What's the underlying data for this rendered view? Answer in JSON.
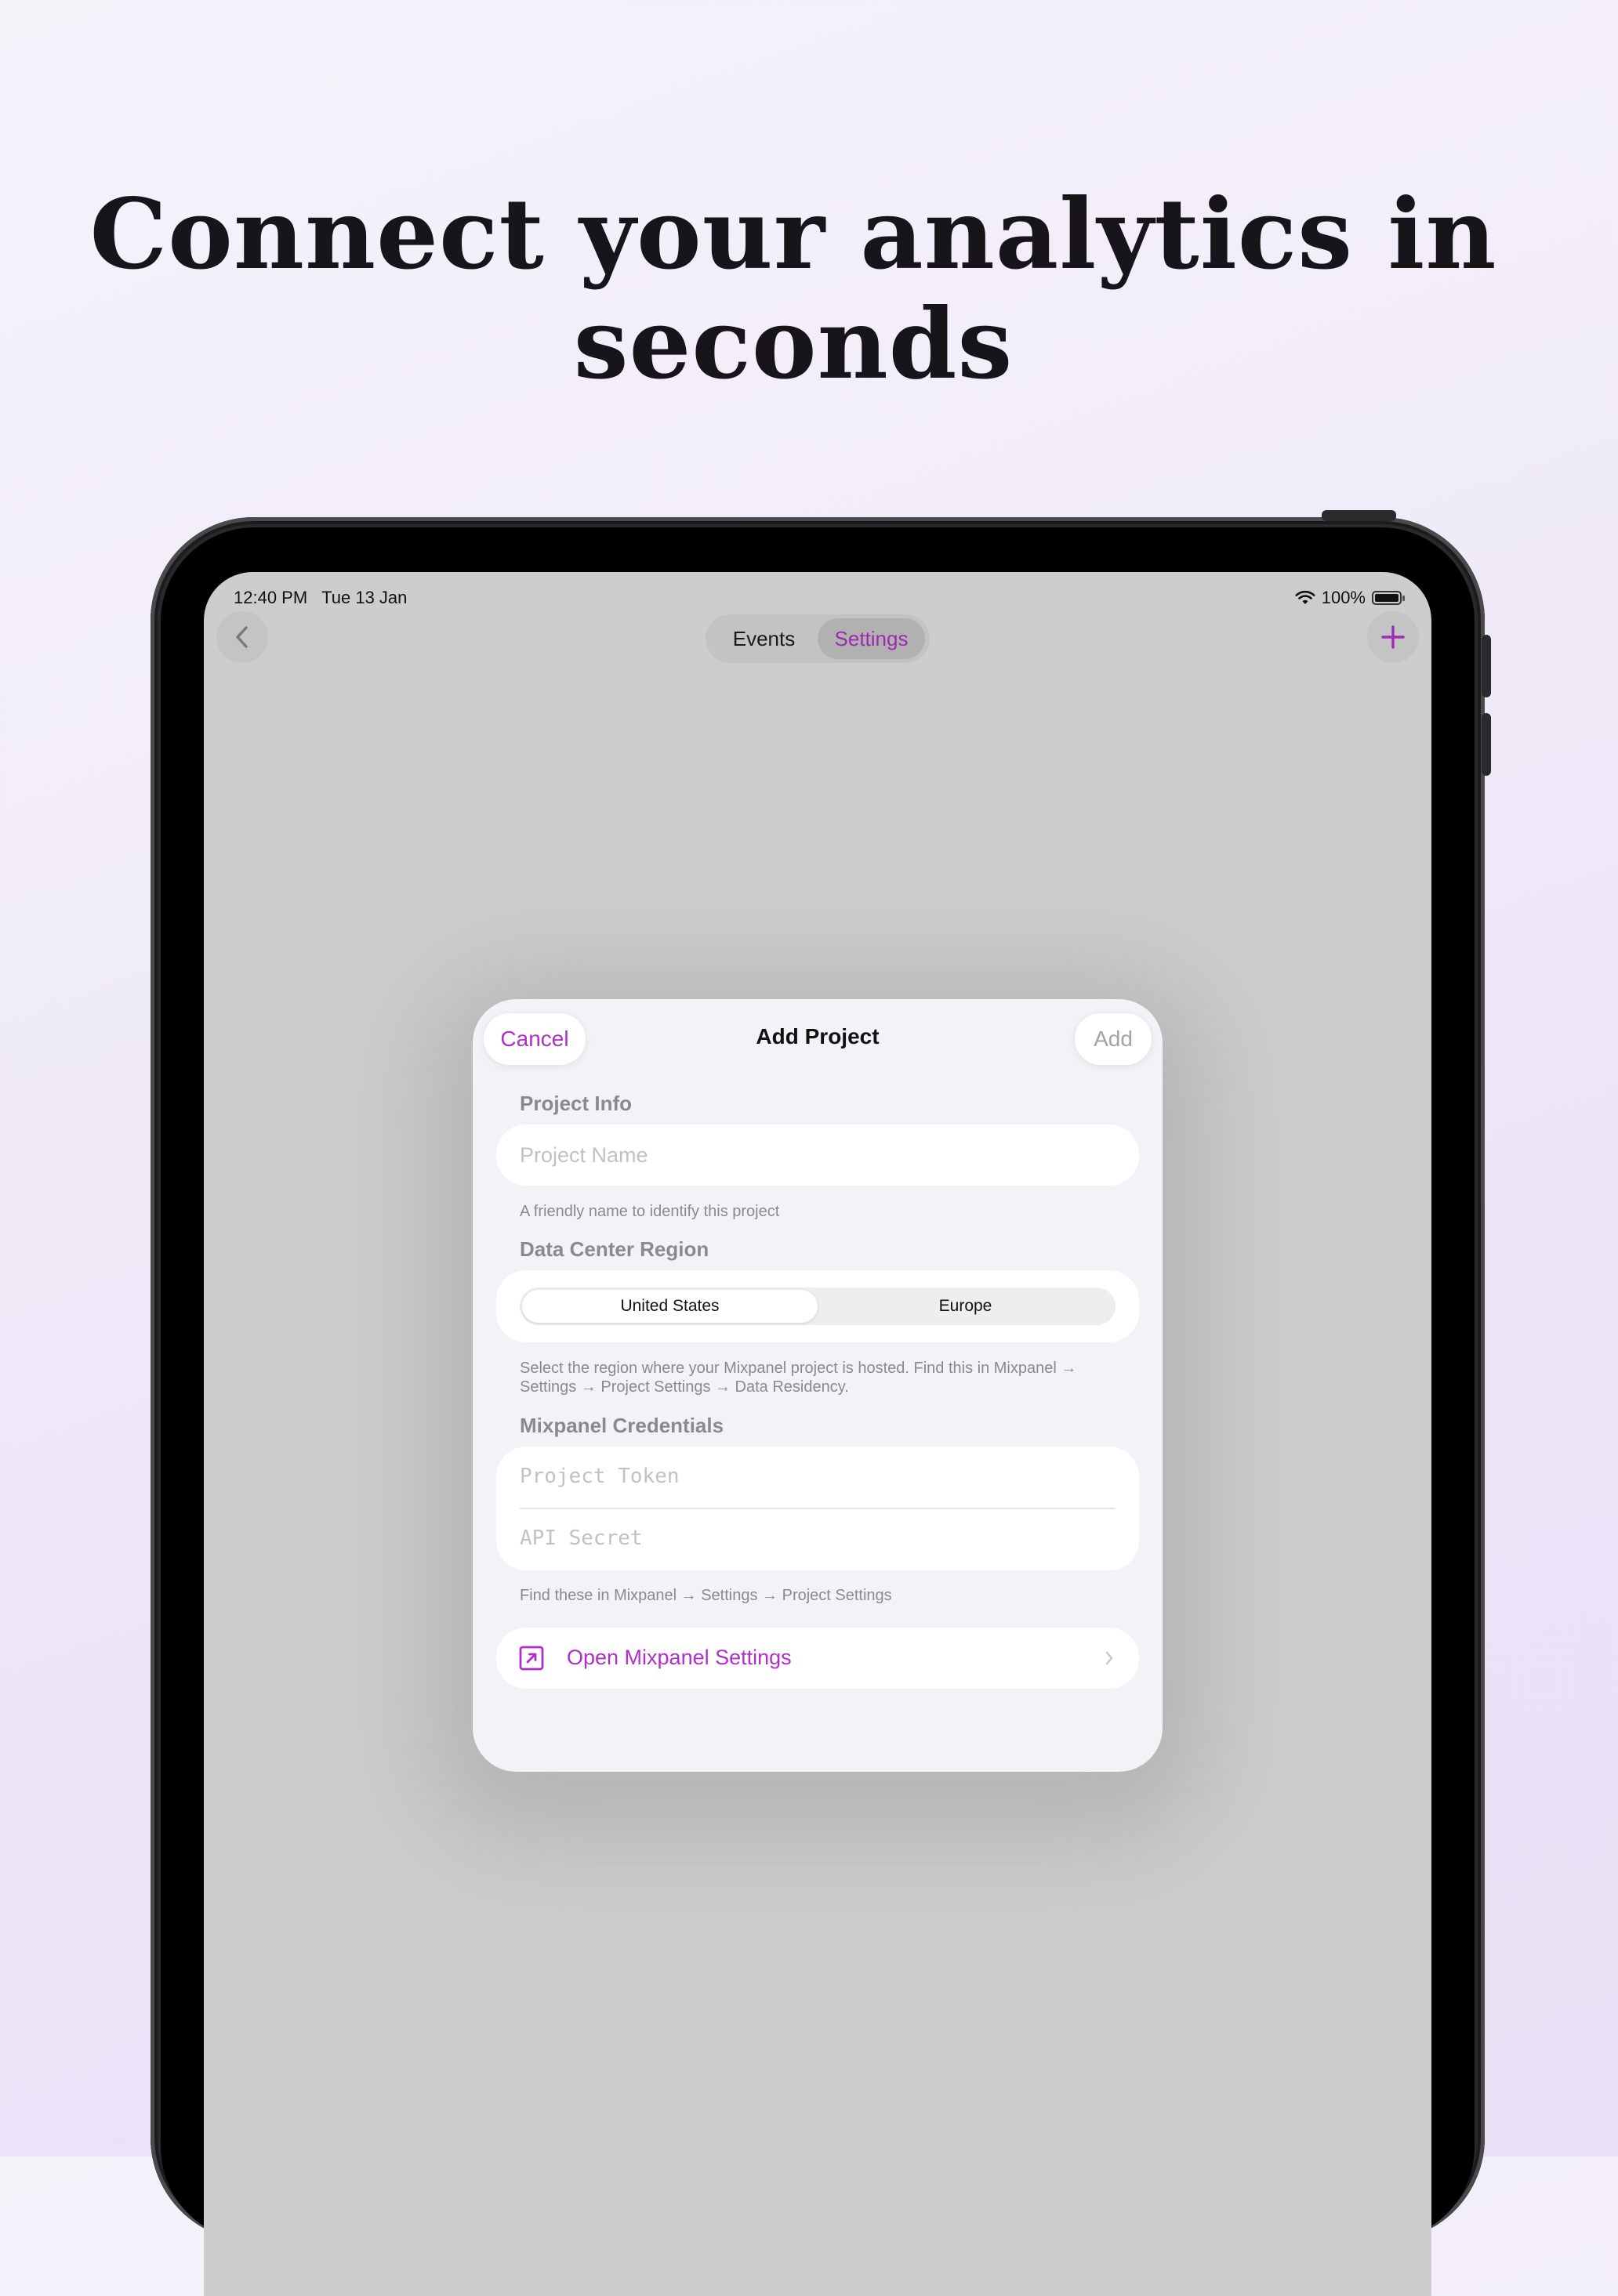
{
  "headline": {
    "line1": "Connect your analytics in",
    "line2": "seconds"
  },
  "status_bar": {
    "time": "12:40 PM",
    "date": "Tue 13 Jan",
    "battery": "100%"
  },
  "nav": {
    "tabs": [
      {
        "label": "Events"
      },
      {
        "label": "Settings"
      }
    ],
    "active_tab": "Settings"
  },
  "modal": {
    "title": "Add Project",
    "cancel_label": "Cancel",
    "add_label": "Add",
    "project_info": {
      "label": "Project Info",
      "name_placeholder": "Project Name",
      "hint": "A friendly name to identify this project"
    },
    "region": {
      "label": "Data Center Region",
      "options": [
        "United States",
        "Europe"
      ],
      "selected": "United States",
      "hint": "Select the region where your Mixpanel project is hosted. Find this in Mixpanel → Settings → Project Settings → Data Residency."
    },
    "credentials": {
      "label": "Mixpanel Credentials",
      "token_placeholder": "Project Token",
      "secret_placeholder": "API Secret",
      "hint": "Find these in Mixpanel → Settings → Project Settings"
    },
    "open_settings": {
      "label": "Open Mixpanel Settings",
      "icon": "external-link-icon"
    }
  },
  "colors": {
    "accent": "#b02fc7",
    "screen_bg": "#cdcdcd",
    "sheet_bg": "#f2f2f7"
  }
}
